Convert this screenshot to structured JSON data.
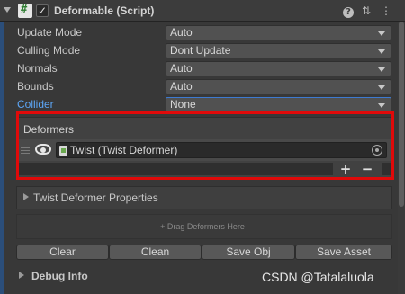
{
  "header": {
    "title": "Deformable (Script)",
    "enabled": true,
    "icons": [
      "foldout-expanded-icon",
      "script-icon",
      "checkbox-checked-icon",
      "help-icon",
      "preset-icon",
      "context-menu-icon"
    ]
  },
  "properties": [
    {
      "label": "Update Mode",
      "value": "Auto"
    },
    {
      "label": "Culling Mode",
      "value": "Dont Update"
    },
    {
      "label": "Normals",
      "value": "Auto"
    },
    {
      "label": "Bounds",
      "value": "Auto"
    },
    {
      "label": "Collider",
      "value": "None"
    }
  ],
  "deformers": {
    "label": "Deformers",
    "items": [
      {
        "name": "Twist (Twist Deformer)",
        "visible": true
      }
    ],
    "add_label": "+",
    "remove_label": "−"
  },
  "twist_foldout": {
    "label": "Twist Deformer Properties"
  },
  "drag_hint": "+ Drag Deformers Here",
  "buttons": {
    "clear": "Clear",
    "clean": "Clean",
    "save_obj": "Save Obj",
    "save_asset": "Save Asset"
  },
  "debug": {
    "label": "Debug Info"
  },
  "watermark": "CSDN @Tatalaluola",
  "colors": {
    "background": "#383838",
    "highlight_box": "#e00a0a",
    "link_label": "#5ca5f5",
    "focus_border": "#3d7ad0"
  }
}
